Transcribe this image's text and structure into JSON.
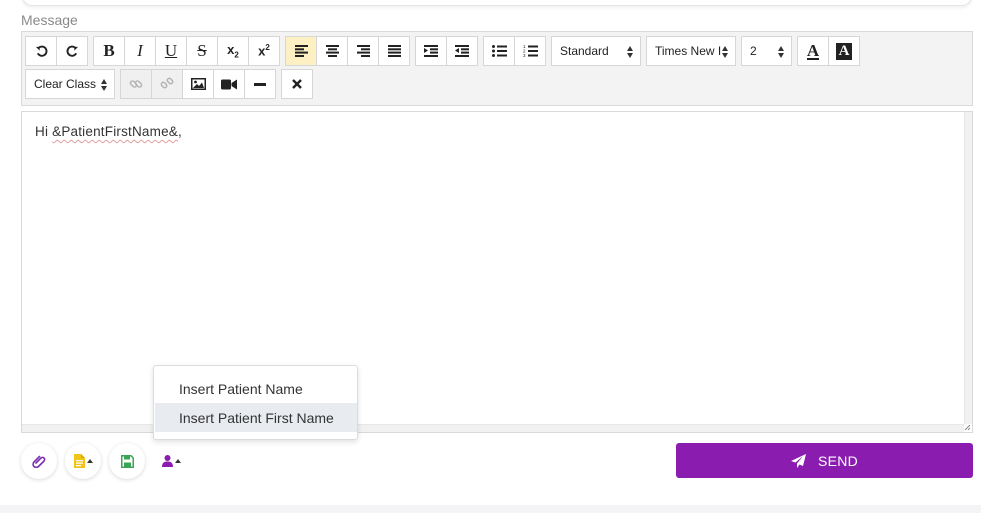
{
  "message_label": "Message",
  "toolbar": {
    "format_select": "Standard",
    "font_select": "Times New I",
    "size_select": "2",
    "clear_class_select": "Clear Class",
    "subscript_label": "x",
    "subscript_sub": "2",
    "superscript_label": "x",
    "superscript_sup": "2",
    "bold_label": "B",
    "italic_label": "I",
    "underline_label": "U",
    "strike_label": "S",
    "font_color_label": "A",
    "bg_color_label": "A",
    "active_alignment": "align-left"
  },
  "editor": {
    "greeting": "Hi ",
    "placeholder_token": "&PatientFirstName&",
    "trailing": ","
  },
  "dropdown": {
    "items": [
      {
        "label": "Insert Patient Name"
      },
      {
        "label": "Insert Patient First Name"
      }
    ],
    "highlighted_index": 1
  },
  "actions": {
    "send_label": "SEND"
  },
  "colors": {
    "send_bg": "#8a1db0",
    "attach_icon": "#7b2fb0",
    "template_icon": "#f0c419",
    "save_icon": "#3aa655",
    "user_icon": "#8a1db0",
    "active_button_bg": "#fdf1c4"
  }
}
